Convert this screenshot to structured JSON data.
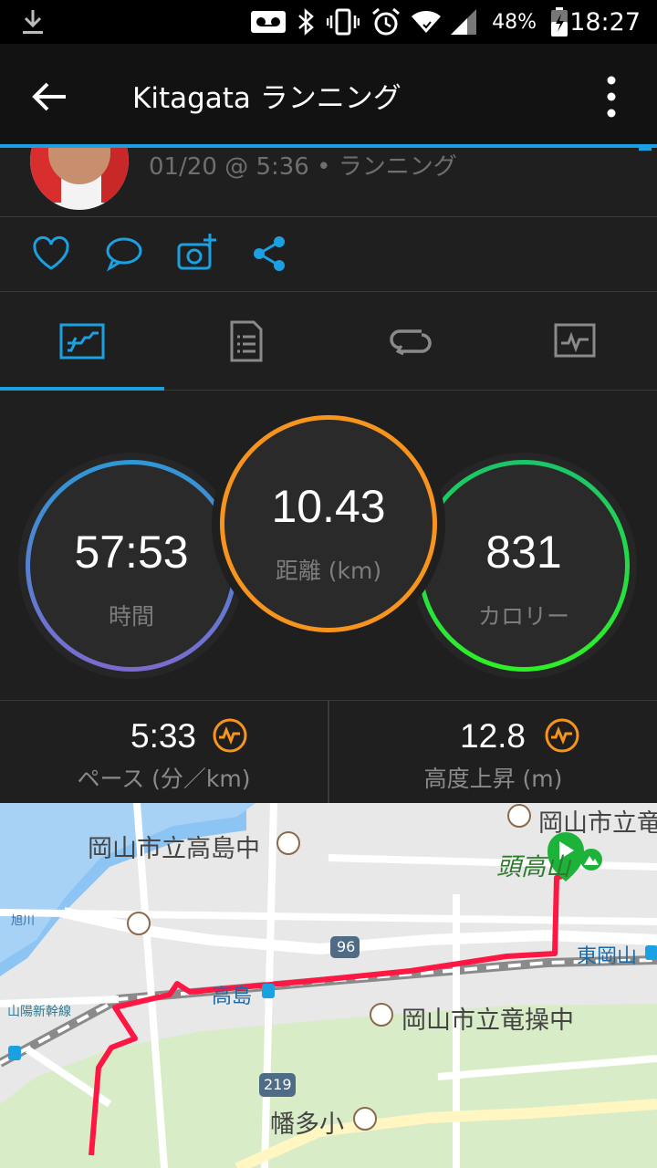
{
  "status_bar": {
    "time": "18:27",
    "battery_percent": "48%",
    "icons": [
      "download-icon",
      "voicemail-icon",
      "bluetooth-icon",
      "vibrate-icon",
      "alarm-icon",
      "wifi-icon",
      "signal-icon",
      "battery-charging-icon"
    ]
  },
  "app_bar": {
    "title": "Kitagata ランニング",
    "back_icon": "arrow-left-icon",
    "menu_icon": "more-vertical-icon"
  },
  "activity_header": {
    "meta": "01/20 @ 5:36 • ランニング"
  },
  "actions": [
    {
      "icon": "heart-icon"
    },
    {
      "icon": "comment-icon"
    },
    {
      "icon": "add-photo-icon"
    },
    {
      "icon": "share-icon"
    }
  ],
  "tabs": [
    {
      "icon": "overview-icon",
      "active": true
    },
    {
      "icon": "stats-list-icon",
      "active": false
    },
    {
      "icon": "laps-icon",
      "active": false
    },
    {
      "icon": "charts-icon",
      "active": false
    }
  ],
  "stats": {
    "time": {
      "value": "57:53",
      "label": "時間"
    },
    "distance": {
      "value": "10.43",
      "label": "距離 (km)"
    },
    "calories": {
      "value": "831",
      "label": "カロリー"
    }
  },
  "sub_stats": {
    "pace": {
      "value": "5:33",
      "label": "ペース (分／km)"
    },
    "elevation": {
      "value": "12.8",
      "label": "高度上昇 (m)"
    }
  },
  "map": {
    "labels": {
      "school_takashima": "岡山市立高島中",
      "school_ryuso": "岡山市立竜操中",
      "school_top": "岡山市立竜",
      "station_takashima": "高島",
      "station_higashiokayama": "東岡山",
      "hatada": "幡多小",
      "kashirataka": "頭高山",
      "shinkansen": "山陽新幹線",
      "asahi": "旭川",
      "route_96": "96",
      "route_219": "219"
    },
    "colors": {
      "route": "#ff1744",
      "water": "#8cc4f4",
      "road": "#ffffff",
      "rail": "#8a8a8a",
      "start": "#1db33b"
    }
  },
  "colors": {
    "accent": "#1ba0e1",
    "time_ring": "#2f97d6",
    "distance_ring": "#f7941d",
    "calorie_ring": "#2ef026",
    "insight_icon": "#f7941d"
  }
}
